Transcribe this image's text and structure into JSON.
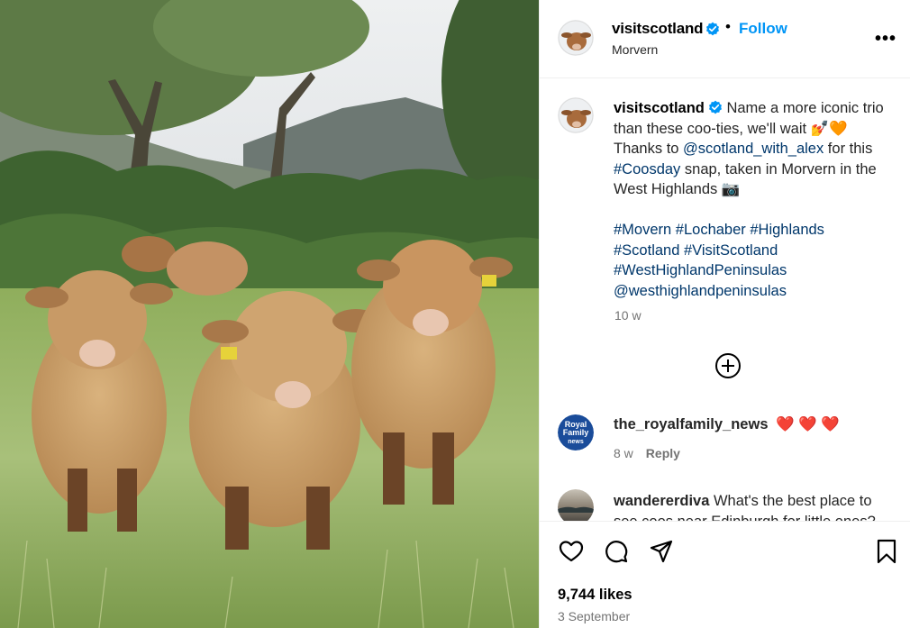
{
  "post": {
    "username": "visitscotland",
    "follow_label": "Follow",
    "separator": "•",
    "location": "Morvern",
    "more_label": "•••"
  },
  "caption": {
    "username": "visitscotland",
    "text_part1": " Name a more iconic trio than these coo-ties, we'll wait 💅🧡 Thanks to ",
    "mention1": "@scotland_with_alex",
    "text_part2": " for this ",
    "hashtag_coosday": "#Coosday",
    "text_part3": " snap, taken in Morvern in the West Highlands 📷",
    "hashtags_line1": [
      "#Movern",
      "#Lochaber",
      "#Highlands"
    ],
    "hashtags_line2": [
      "#Scotland",
      "#VisitScotland"
    ],
    "hashtags_line3": [
      "#WestHighlandPeninsulas"
    ],
    "mention2": "@westhighlandpeninsulas",
    "time": "10 w"
  },
  "comments": [
    {
      "username": "the_royalfamily_news",
      "text": "❤️ ❤️ ❤️",
      "time": "8 w",
      "reply_label": "Reply",
      "avatar_text": [
        "Royal",
        "Family",
        "news"
      ]
    },
    {
      "username": "wandererdiva",
      "text": "What's the best place to see coos near Edinburgh for little ones?"
    }
  ],
  "actions": {
    "likes": "9,744 likes",
    "date": "3 September"
  },
  "colors": {
    "accent": "#0095f6",
    "verified": "#0095f6",
    "hashtag": "#00376b",
    "muted": "#737373"
  },
  "icons": [
    "verified-badge-icon",
    "more-options-icon",
    "load-more-comments-icon",
    "heart-icon",
    "comment-icon",
    "share-icon",
    "bookmark-icon"
  ]
}
